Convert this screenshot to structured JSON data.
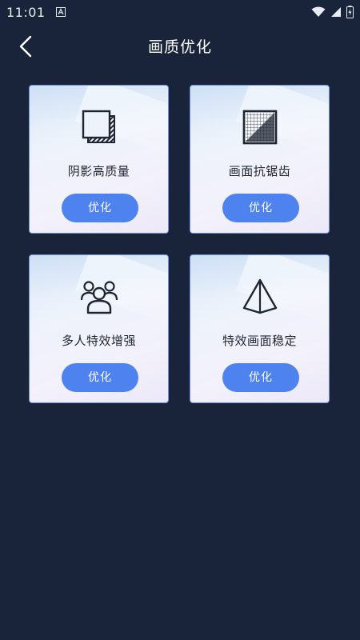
{
  "status_bar": {
    "time": "11:01",
    "icons": [
      "notification-a-icon",
      "wifi-icon",
      "signal-icon",
      "battery-icon"
    ]
  },
  "header": {
    "title": "画质优化",
    "back_icon": "chevron-left-icon"
  },
  "cards": [
    {
      "label": "阴影高质量",
      "button": "优化",
      "icon": "layered-squares-icon"
    },
    {
      "label": "画面抗锯齿",
      "button": "优化",
      "icon": "pixel-grid-icon"
    },
    {
      "label": "多人特效增强",
      "button": "优化",
      "icon": "people-group-icon"
    },
    {
      "label": "特效画面稳定",
      "button": "优化",
      "icon": "pyramid-icon"
    }
  ],
  "colors": {
    "background": "#19243a",
    "button": "#4e82ee",
    "card_border": "#6f8fe0"
  }
}
